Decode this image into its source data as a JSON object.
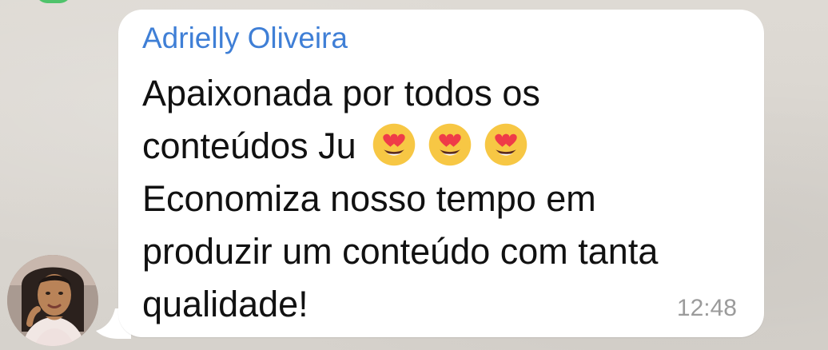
{
  "chat": {
    "sender_name": "Adrielly Oliveira",
    "message_lines": [
      "Apaixonada por todos os",
      "conteúdos Ju",
      "Economiza nosso tempo em",
      "produzir um conteúdo com tanta",
      "qualidade!"
    ],
    "timestamp": "12:48",
    "emojis": [
      "smiling-face-with-heart-eyes",
      "smiling-face-with-heart-eyes",
      "smiling-face-with-heart-eyes"
    ],
    "colors": {
      "sender_name": "#3f7fd6",
      "bubble": "#ffffff",
      "message_text": "#111111",
      "timestamp": "#9b9b9b",
      "background": "#d9d5cf"
    }
  }
}
